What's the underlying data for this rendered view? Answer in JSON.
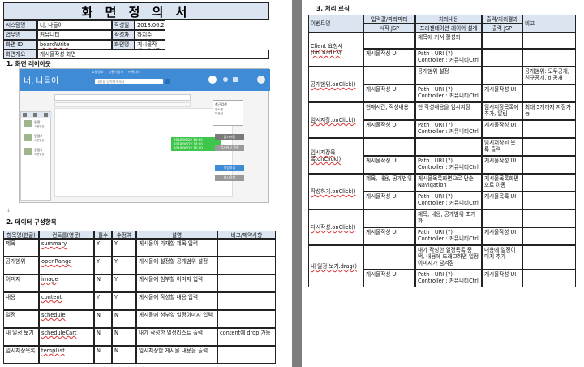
{
  "doc": {
    "title": "화 면 정 의 서",
    "info": [
      [
        "시스템명",
        "너, 나들이",
        "작성일",
        "2018.06.25"
      ],
      [
        "업무명",
        "커뮤니티",
        "작성자",
        "하지수"
      ],
      [
        "화면 ID",
        "boardWrite",
        "화면명",
        "게시물작성, 게시물수정"
      ]
    ],
    "summary_label": "화면개요",
    "summary_value": "게시물작성 화면",
    "section1": "1. 화면 레이아웃",
    "section2": "2. 데이터 구성항목",
    "section3": "3. 처리 로직"
  },
  "mock": {
    "brand": "너, 나들이",
    "search_placeholder": "내용을 입력해주세요",
    "nav": [
      "호텔정보",
      "나들이정보",
      "커뮤니티"
    ],
    "side_title": "최근검색",
    "side_items": [
      "장소명",
      "보관됨"
    ],
    "list_items": [
      {
        "name": "일정1",
        "sub": "소풍일정"
      },
      {
        "name": "일정2",
        "sub": "소풍일정"
      },
      {
        "name": "일정3",
        "sub": "소풍일정"
      }
    ],
    "green_lines": [
      "2018/06/22 10:00",
      "2018/06/22 14:00",
      "2018/06/22 16:00"
    ],
    "buttons": [
      "임시저장",
      "임시저장 목록",
      "작성하기",
      "다시작성"
    ]
  },
  "data_table": {
    "headers": [
      "항목명(한글)",
      "컨트롤(영문)",
      "필수",
      "수정여부",
      "설명",
      "비고/제약사항"
    ],
    "rows": [
      [
        "제목",
        "summary",
        "Y",
        "Y",
        "게시물이 가재할 제목 입력",
        ""
      ],
      [
        "공개범위",
        "openRange",
        "Y",
        "Y",
        "게시물에 설정할 공개범위 설정",
        ""
      ],
      [
        "이미지",
        "image",
        "N",
        "Y",
        "게시물에 첨부할 이미지 입력",
        ""
      ],
      [
        "내용",
        "content",
        "Y",
        "Y",
        "게시물에 작성할 내용 입력",
        ""
      ],
      [
        "일정",
        "schedule",
        "N",
        "N",
        "게시물에 첨부할 일정이미지 입력",
        ""
      ],
      [
        "내 일정 보기",
        "scheduleCart",
        "N",
        "N",
        "내가 작성한 일정리스트 출력",
        "content에 drop 가능"
      ],
      [
        "임시저장목록",
        "tempList",
        "N",
        "N",
        "임시저장한 게시물 내용을 출력",
        ""
      ]
    ]
  },
  "logic_table": {
    "headers": {
      "event": "이벤트명",
      "input": "입력값/파라미터",
      "input_sub": "시작 JSP",
      "process": "처리내용",
      "process_sub": "프리젠테이션 레이어 설계",
      "output": "출력/처리결과",
      "output_sub": "출력 JSP",
      "note": "비고"
    },
    "groups": [
      {
        "event": "Client 요청시 (onLoad) 시",
        "rows": [
          {
            "input": "",
            "process": "제목에 커서 활성화",
            "output": "",
            "note": ""
          },
          {
            "input": "게시물작성 UI",
            "process": "Path : URI (?)\nController : 커뮤니티Ctrl",
            "output": "",
            "note": ""
          }
        ]
      },
      {
        "event": "공개범위.onClick()",
        "rows": [
          {
            "input": "",
            "process": "공개범위 설정",
            "output": "",
            "note": "공개범위: 모두공개, 친구공개, 비공개"
          },
          {
            "input": "게시물작성 UI",
            "process": "Path : URI (?)\nController : 커뮤니티Ctrl",
            "output": "게시물작성 UI",
            "note": ""
          }
        ]
      },
      {
        "event": "임시저장.onClick()",
        "rows": [
          {
            "input": "현재시간, 작성내용",
            "process": "현 작성내용을 임시저장",
            "output": "임시저장목록에 추가, 알림",
            "note": "최대 5개까지 저장가능"
          },
          {
            "input": "게시물작성 UI",
            "process": "Path : URI (?)\nController : 커뮤니티Ctrl",
            "output": "게시물작성 UI",
            "note": ""
          }
        ]
      },
      {
        "event": "임시저장목록.onClick()",
        "rows": [
          {
            "input": "",
            "process": "",
            "output": "임시저장된 목록 출력",
            "note": ""
          },
          {
            "input": "게시물작성 UI",
            "process": "Path : URI (?)\nController : 커뮤니티Ctrl",
            "output": "게시물작성 UI",
            "note": ""
          }
        ]
      },
      {
        "event": "작성하기.onClick()",
        "rows": [
          {
            "input": "제목, 내용, 공개범위",
            "process": "게시물목록화면으로 단순 Navigation",
            "output": "게시물목록화면으로 이동",
            "note": ""
          },
          {
            "input": "게시물작성 UI",
            "process": "Path : URI (?)\nController : 커뮤니티Ctrl",
            "output": "게시물목록 UI",
            "note": ""
          }
        ]
      },
      {
        "event": "다시작성.onClick()",
        "rows": [
          {
            "input": "",
            "process": "제목, 내용, 공개범위 초기화",
            "output": "",
            "note": ""
          },
          {
            "input": "게시물작성 UI",
            "process": "Path : URI (?)\nController : 커뮤니티Ctrl",
            "output": "게시물작성 UI",
            "note": ""
          }
        ]
      },
      {
        "event": "내 일정 보기.drag()",
        "rows": [
          {
            "input": "",
            "process": "내가 작성한 일정목록 중 택, 내용에 드래그하면 일정이미지가 담겨짐",
            "output": "내용에 일정이미지 추가",
            "note": ""
          },
          {
            "input": "게시물작성 UI",
            "process": "Path : URI (?)\nController : 커뮤니티Ctrl",
            "output": "게시물작성 UI",
            "note": ""
          }
        ]
      }
    ]
  }
}
